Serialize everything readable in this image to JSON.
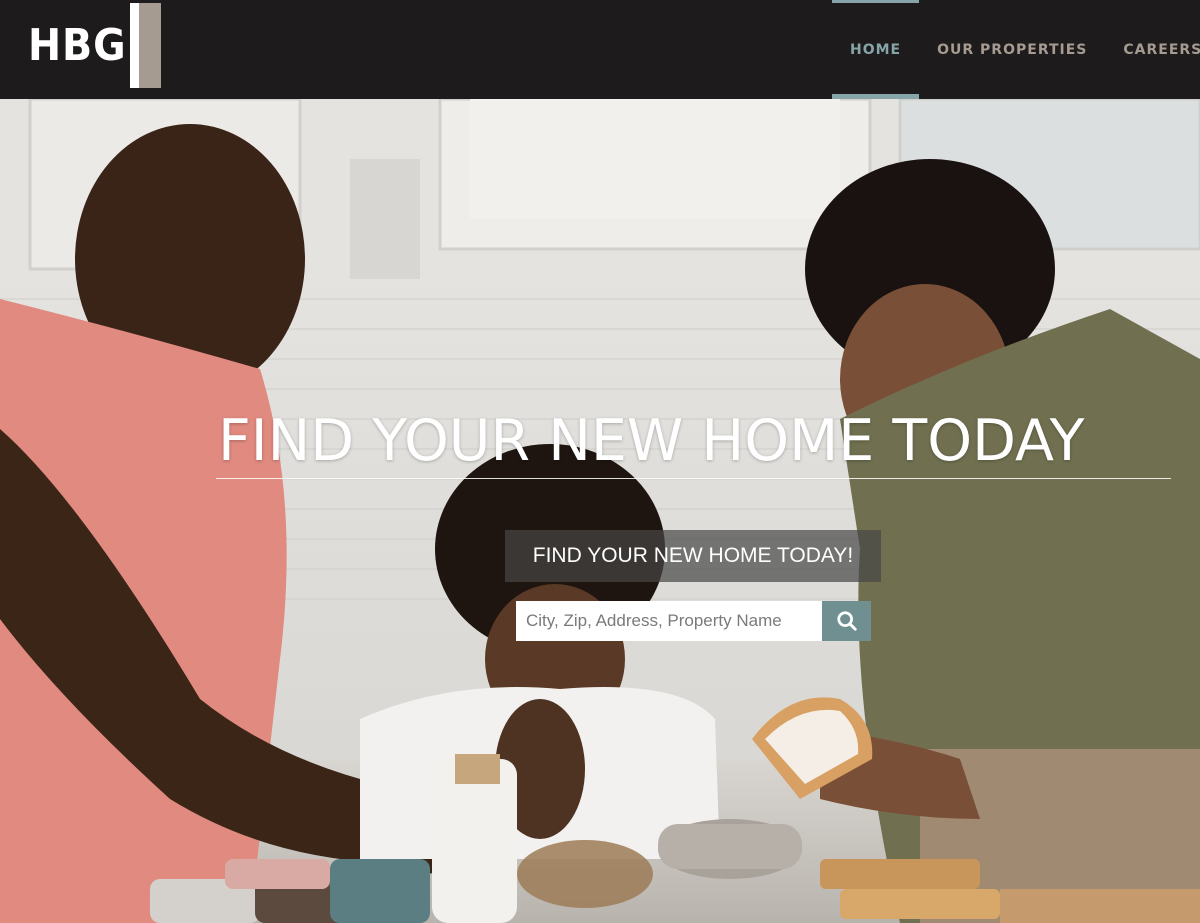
{
  "brand": {
    "logo_text": "HBG"
  },
  "nav": {
    "items": [
      {
        "label": "HOME",
        "active": true
      },
      {
        "label": "OUR PROPERTIES",
        "active": false
      },
      {
        "label": "CAREERS",
        "active": false
      }
    ]
  },
  "hero": {
    "headline": "FIND YOUR NEW HOME TODAY",
    "search_label": "FIND YOUR NEW HOME TODAY!",
    "search_placeholder": "City, Zip, Address, Property Name",
    "search_icon": "search-icon"
  },
  "colors": {
    "header_bg": "#1e1b1c",
    "nav_text": "#a59b91",
    "nav_active": "#86a5a8",
    "search_button": "#6f8f91"
  }
}
